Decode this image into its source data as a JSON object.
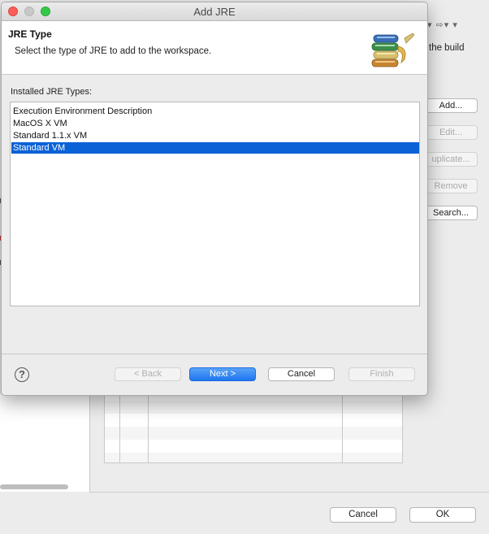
{
  "background": {
    "build_text": "the build",
    "toolbar_glyphs": "▾ ⇨▾ ▾",
    "side_buttons": [
      {
        "label": "Add...",
        "disabled": false
      },
      {
        "label": "Edit...",
        "disabled": true
      },
      {
        "label": "uplicate...",
        "disabled": true
      },
      {
        "label": "Remove",
        "disabled": true
      },
      {
        "label": "Search...",
        "disabled": false
      }
    ],
    "footer": {
      "cancel_label": "Cancel",
      "ok_label": "OK"
    }
  },
  "dialog": {
    "title": "Add JRE",
    "header": {
      "title": "JRE Type",
      "description": "Select the type of JRE to add to the workspace.",
      "icon": "books-icon"
    },
    "installed_label": "Installed JRE Types:",
    "jre_types": [
      {
        "label": "Execution Environment Description",
        "selected": false
      },
      {
        "label": "MacOS X VM",
        "selected": false
      },
      {
        "label": "Standard 1.1.x VM",
        "selected": false
      },
      {
        "label": "Standard VM",
        "selected": true
      }
    ],
    "buttons": {
      "help_icon": "help-icon",
      "back_label": "< Back",
      "next_label": "Next >",
      "cancel_label": "Cancel",
      "finish_label": "Finish"
    },
    "colors": {
      "selection": "#0b62d6",
      "primary_button": "#1e76ef",
      "close": "#fc5f57",
      "maximize": "#34c84a"
    }
  }
}
